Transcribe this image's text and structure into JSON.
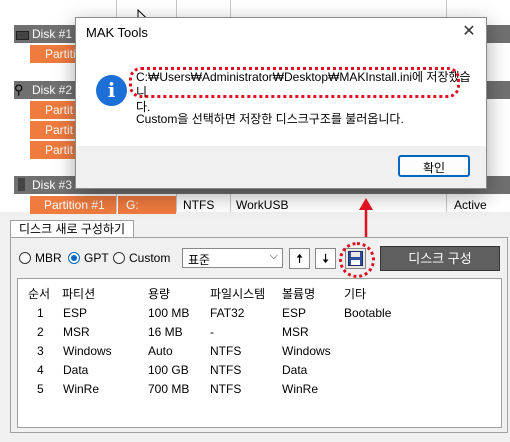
{
  "disks": [
    {
      "name": "Disk #1",
      "partitions": [
        {
          "name": "Partiti"
        }
      ]
    },
    {
      "name": "Disk #2",
      "partitions": [
        {
          "name": "Partit"
        },
        {
          "name": "Partit"
        },
        {
          "name": "Partit"
        }
      ]
    },
    {
      "name": "Disk #3",
      "partitions": [
        {
          "name": "Partition #1",
          "letter": "G:",
          "fs": "NTFS",
          "label": "WorkUSB",
          "status": "Active"
        }
      ]
    }
  ],
  "dialog": {
    "title": "MAK Tools",
    "message_line1": "C:₩Users₩Administrator₩Desktop₩MAKInstall.ini에 저장했습니",
    "message_line1b": "다.",
    "message_line2": "Custom을 선택하면 저장한 디스크구조를 불러옵니다.",
    "ok_label": "확인",
    "close_glyph": "✕"
  },
  "rebuild": {
    "tab_label": "디스크 새로 구성하기",
    "radio_mbr": "MBR",
    "radio_gpt": "GPT",
    "radio_custom": "Custom",
    "selected_radio": "GPT",
    "preset_value": "표준",
    "build_label": "디스크 구성",
    "up_glyph": "🠅",
    "down_glyph": "🠇",
    "save_glyph": "💾"
  },
  "table": {
    "columns": [
      "순서",
      "파티션",
      "용량",
      "파일시스템",
      "볼륨명",
      "기타"
    ],
    "rows": [
      [
        "1",
        "ESP",
        "100 MB",
        "FAT32",
        "ESP",
        "Bootable"
      ],
      [
        "2",
        "MSR",
        "16 MB",
        "-",
        "MSR",
        ""
      ],
      [
        "3",
        "Windows",
        "Auto",
        "NTFS",
        "Windows",
        ""
      ],
      [
        "4",
        "Data",
        "100 GB",
        "NTFS",
        "Data",
        ""
      ],
      [
        "5",
        "WinRe",
        "700 MB",
        "NTFS",
        "WinRe",
        ""
      ]
    ]
  },
  "colors": {
    "accent": "#0067c0",
    "partition": "#f07b3f",
    "highlight": "#e01020"
  }
}
